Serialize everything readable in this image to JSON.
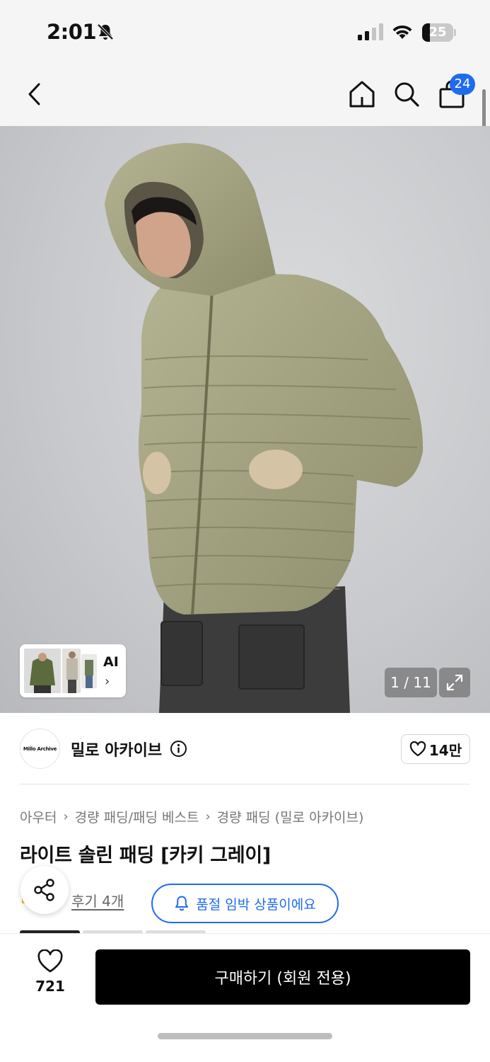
{
  "status_bar": {
    "time": "2:01",
    "battery_percent": "25",
    "battery_level": 0.25
  },
  "nav": {
    "cart_count": "24"
  },
  "hero": {
    "ai_label": "AI",
    "ai_chevron": "›",
    "page_indicator": "1 / 11"
  },
  "brand": {
    "logo_text": "Millo Archive",
    "name": "밀로 아카이브",
    "likes": "14만"
  },
  "breadcrumb": [
    "아우터",
    "경량 패딩/패딩 베스트",
    "경량 패딩 (밀로 아카이브)"
  ],
  "product": {
    "title": "라이트 솔린 패딩 [카키 그레이]",
    "review_link": "후기 4개",
    "soldout_notice": "품절 임박 상품이에요"
  },
  "bottom_bar": {
    "wish_count": "721",
    "buy_label": "구매하기 (회원 전용)"
  },
  "colors": {
    "accent": "#1f6bf0",
    "buy_button": "#000000",
    "jacket": "#a7a683"
  }
}
